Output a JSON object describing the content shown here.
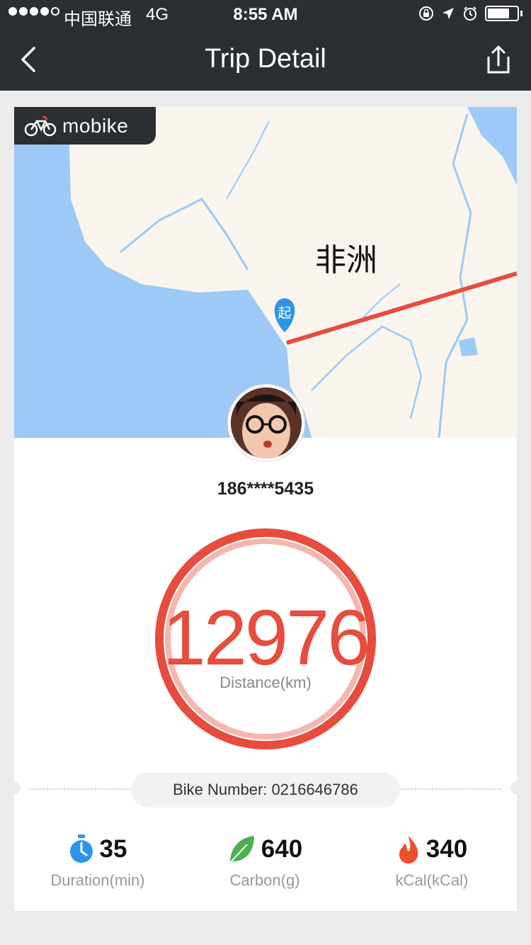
{
  "status_bar": {
    "carrier": "中国联通",
    "network": "4G",
    "time": "8:55 AM"
  },
  "nav": {
    "title": "Trip Detail"
  },
  "map": {
    "brand": "mobike",
    "region_label": "非洲",
    "start_marker": "起"
  },
  "user": {
    "phone": "186****5435"
  },
  "trip": {
    "distance_value": "12976",
    "distance_label": "Distance(km)",
    "bike_number": "Bike Number: 0216646786"
  },
  "stats": [
    {
      "value": "35",
      "label": "Duration(min)",
      "icon": "stopwatch-icon"
    },
    {
      "value": "640",
      "label": "Carbon(g)",
      "icon": "leaf-icon"
    },
    {
      "value": "340",
      "label": "kCal(kCal)",
      "icon": "flame-icon"
    }
  ],
  "colors": {
    "accent": "#e74c3c",
    "nav_bg": "#2b2e33",
    "map_water": "#9cc9f5",
    "map_land": "#f9f5ee",
    "marker": "#2b95e9",
    "leaf": "#4caf50"
  }
}
